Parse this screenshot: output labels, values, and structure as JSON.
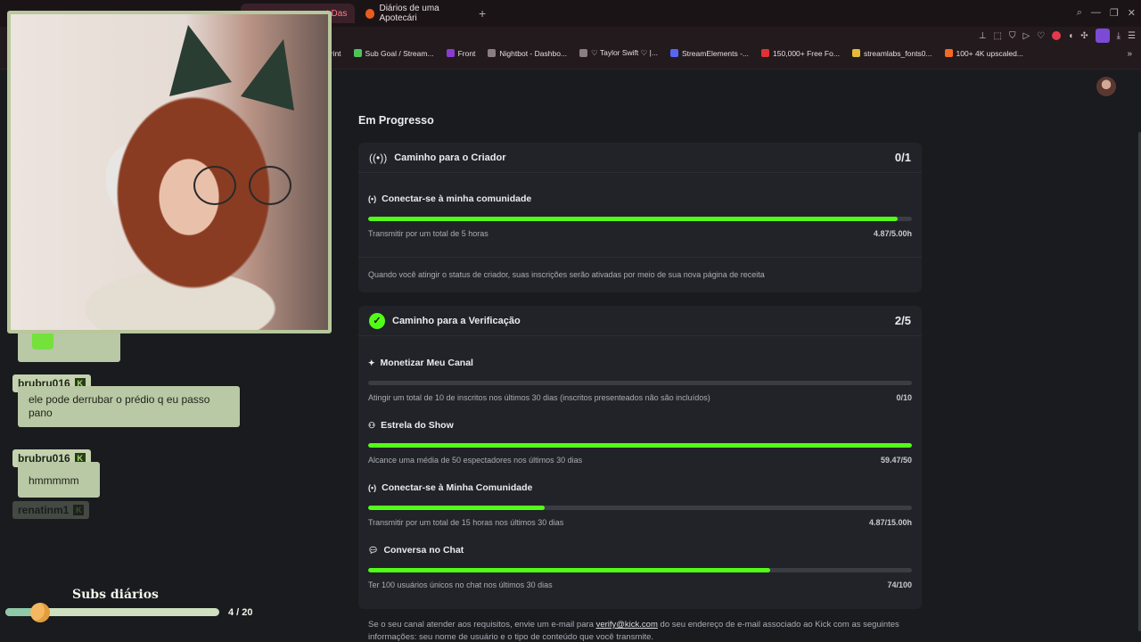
{
  "browser": {
    "tabs": [
      {
        "label": "t Das",
        "active": true
      },
      {
        "label": "Diários de uma Apotecári",
        "active": false
      }
    ],
    "new_tab": "+",
    "bookmarks": [
      {
        "label": "print",
        "icon": "page-icon"
      },
      {
        "label": "Sub Goal / Stream...",
        "icon": "green-square-icon"
      },
      {
        "label": "Front",
        "icon": "list-icon"
      },
      {
        "label": "Nightbot - Dashbo...",
        "icon": "bot-icon"
      },
      {
        "label": "♡ Taylor Swift ♡ |...",
        "icon": "page-icon"
      },
      {
        "label": "StreamElements -...",
        "icon": "streamelements-icon"
      },
      {
        "label": "150,000+ Free Fo...",
        "icon": "font-icon"
      },
      {
        "label": "streamlabs_fonts0...",
        "icon": "drive-icon"
      },
      {
        "label": "100+ 4K upscaled...",
        "icon": "reddit-icon"
      }
    ],
    "bookmarks_more": "»"
  },
  "page": {
    "section_title": "Em Progresso",
    "creator_card": {
      "title": "Caminho para o Criador",
      "count": "0/1",
      "goal": {
        "title": "Conectar-se à minha comunidade",
        "description": "Transmitir por um total de 5 horas",
        "value": "4.87/5.00h",
        "progress": 0.974
      },
      "note": "Quando você atingir o status de criador, suas inscrições serão ativadas por meio de sua nova página de receita"
    },
    "verification_card": {
      "title": "Caminho para a Verificação",
      "count": "2/5",
      "goals": [
        {
          "title": "Monetizar Meu Canal",
          "description": "Atingir um total de 10 de inscritos nos últimos 30 dias (inscritos presenteados não são incluídos)",
          "value": "0/10",
          "progress": 0.0,
          "icon": "sparkle-icon"
        },
        {
          "title": "Estrela do Show",
          "description": "Alcance uma média de 50 espectadores nos últimos 30 dias",
          "value": "59.47/50",
          "progress": 1.0,
          "icon": "users-icon"
        },
        {
          "title": "Conectar-se à Minha Comunidade",
          "description": "Transmitir por um total de 15 horas nos últimos 30 dias",
          "value": "4.87/15.00h",
          "progress": 0.325,
          "icon": "broadcast-icon"
        },
        {
          "title": "Conversa no Chat",
          "description": "Ter 100 usuários únicos no chat nos últimos 30 dias",
          "value": "74/100",
          "progress": 0.74,
          "icon": "chat-icon"
        }
      ]
    },
    "footer": {
      "before": "Se o seu canal atender aos requisitos, envie um e-mail para ",
      "link": "verify@kick.com",
      "after": " do seu endereço de e-mail associado ao Kick com as seguintes informações: seu nome de usuário e o tipo de conteúdo que você transmite."
    }
  },
  "overlay": {
    "chat": [
      {
        "user": "brubru016",
        "message": "ele pode derrubar o prédio q eu passo pano"
      },
      {
        "user": "brubru016",
        "message": "hmmmmm"
      },
      {
        "user": "renatinm1",
        "message": ""
      }
    ],
    "subs_title": "Subs diários",
    "subs_count": "4 / 20",
    "subs_progress": 0.2
  },
  "colors": {
    "accent": "#53fc18",
    "background": "#191b1f",
    "card": "#212328",
    "chat_bubble": "#b9c8a5",
    "webcam_border": "#b9c79c"
  }
}
